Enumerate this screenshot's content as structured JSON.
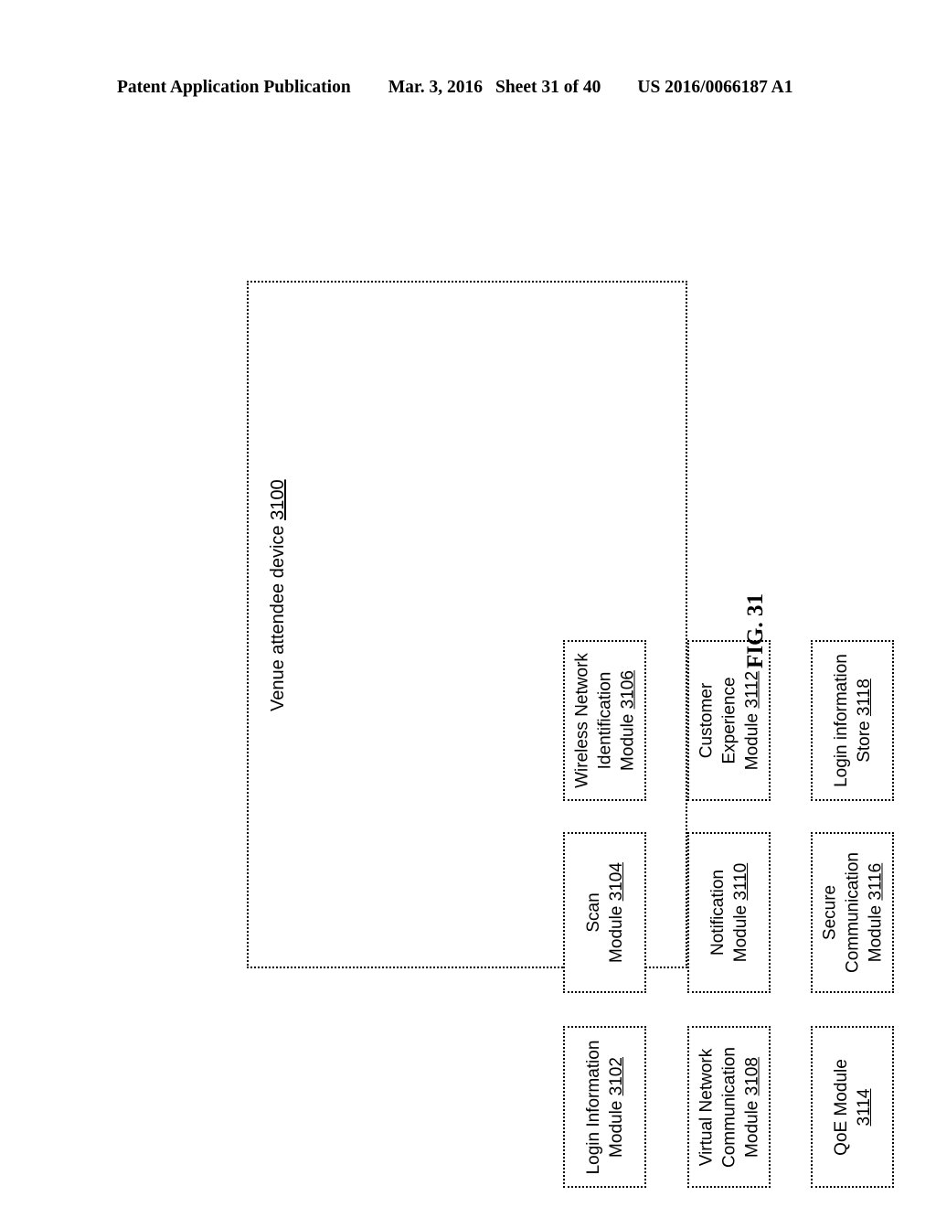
{
  "header": {
    "publication": "Patent Application Publication",
    "date": "Mar. 3, 2016",
    "sheet": "Sheet 31 of 40",
    "document_number": "US 2016/0066187 A1"
  },
  "figure": {
    "caption": "FIG. 31",
    "container": {
      "label": "Venue attendee device",
      "reference_numeral": "3100",
      "border_style": "dotted"
    },
    "modules": [
      {
        "id": "module-3106",
        "lines": [
          "Wireless Network",
          "Identification",
          "Module"
        ],
        "reference_numeral": "3106",
        "ref_inline_with_last_line": true,
        "column": 1,
        "row": 1
      },
      {
        "id": "module-3112",
        "lines": [
          "Customer",
          "Experience",
          "Module"
        ],
        "reference_numeral": "3112",
        "ref_inline_with_last_line": true,
        "column": 2,
        "row": 1
      },
      {
        "id": "store-3118",
        "lines": [
          "Login information",
          "Store"
        ],
        "reference_numeral": "3118",
        "ref_inline_with_last_line": true,
        "column": 3,
        "row": 1
      },
      {
        "id": "module-3104",
        "lines": [
          "Scan",
          "Module"
        ],
        "reference_numeral": "3104",
        "ref_inline_with_last_line": true,
        "column": 1,
        "row": 2
      },
      {
        "id": "module-3110",
        "lines": [
          "Notification",
          "Module"
        ],
        "reference_numeral": "3110",
        "ref_inline_with_last_line": true,
        "column": 2,
        "row": 2
      },
      {
        "id": "module-3116",
        "lines": [
          "Secure",
          "Communication",
          "Module"
        ],
        "reference_numeral": "3116",
        "ref_inline_with_last_line": true,
        "column": 3,
        "row": 2
      },
      {
        "id": "module-3102",
        "lines": [
          "Login Information",
          "Module"
        ],
        "reference_numeral": "3102",
        "ref_inline_with_last_line": true,
        "column": 1,
        "row": 3
      },
      {
        "id": "module-3108",
        "lines": [
          "Virtual Network",
          "Communication",
          "Module"
        ],
        "reference_numeral": "3108",
        "ref_inline_with_last_line": true,
        "column": 2,
        "row": 3
      },
      {
        "id": "module-3114",
        "lines": [
          "QoE Module"
        ],
        "reference_numeral": "3114",
        "ref_inline_with_last_line": false,
        "column": 3,
        "row": 3
      }
    ]
  },
  "colors": {
    "ink": "#000000",
    "paper": "#ffffff"
  }
}
